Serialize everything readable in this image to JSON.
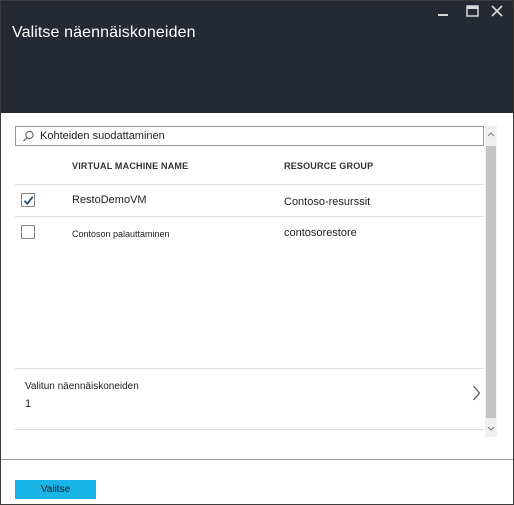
{
  "window": {
    "title": "Valitse näennäiskoneiden",
    "controls": [
      "minimize-icon",
      "maximize-icon",
      "close-icon"
    ]
  },
  "filter": {
    "value": "Kohteiden suodattaminen",
    "icon": "search-icon"
  },
  "table": {
    "columns": [
      "VIRTUAL MACHINE NAME",
      "RESOURCE GROUP"
    ],
    "rows": [
      {
        "checked": true,
        "name": "RestoDemoVM",
        "group": "Contoso-resurssit"
      },
      {
        "checked": false,
        "name": "Contoson palauttaminen",
        "group": "contosorestore"
      }
    ]
  },
  "summary": {
    "label": "Valitun näennäiskoneiden",
    "count": "1"
  },
  "footer": {
    "select_label": "Valitse"
  },
  "colors": {
    "header_bg": "#252a32",
    "accent_button": "#19b4e8",
    "checkmark": "#1f4e79"
  }
}
